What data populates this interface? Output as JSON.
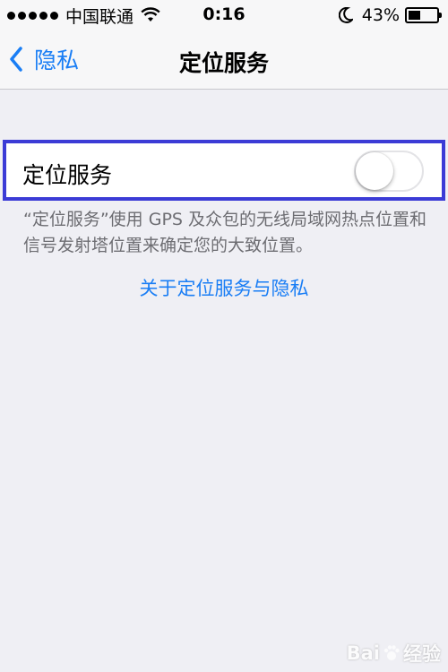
{
  "status_bar": {
    "carrier": "中国联通",
    "time": "0:16",
    "battery_percent": "43%",
    "battery_level": 0.43
  },
  "nav": {
    "back_label": "隐私",
    "title": "定位服务"
  },
  "location_services": {
    "label": "定位服务",
    "enabled": false
  },
  "footer": {
    "description": "“定位服务”使用 GPS 及众包的无线局域网热点位置和信号发射塔位置来确定您的大致位置。",
    "link": "关于定位服务与隐私"
  },
  "watermark": {
    "brand": "Bai",
    "suffix": "经验"
  },
  "colors": {
    "accent": "#1a7ef5",
    "background": "#efeff4",
    "highlight_border": "#3b3bd6"
  }
}
